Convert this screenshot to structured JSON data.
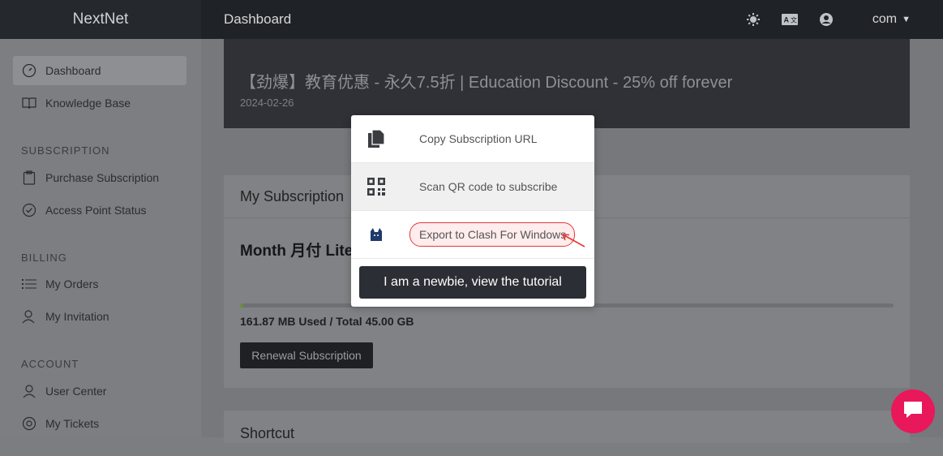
{
  "app": {
    "brand": "NextNet",
    "page_title": "Dashboard"
  },
  "topbar": {
    "theme_icon": "sun-icon",
    "language_icon": "translate-icon",
    "user_icon": "user-circle-icon",
    "user_name": "com"
  },
  "sidebar": {
    "items": [
      {
        "label": "Dashboard",
        "icon": "speedometer-icon",
        "active": true
      },
      {
        "label": "Knowledge Base",
        "icon": "book-icon"
      }
    ],
    "sections": [
      {
        "title": "SUBSCRIPTION",
        "items": [
          {
            "label": "Purchase Subscription",
            "icon": "clipboard-icon"
          },
          {
            "label": "Access Point Status",
            "icon": "check-circle-icon"
          }
        ]
      },
      {
        "title": "BILLING",
        "items": [
          {
            "label": "My Orders",
            "icon": "list-icon"
          },
          {
            "label": "My Invitation",
            "icon": "users-icon"
          }
        ]
      },
      {
        "title": "ACCOUNT",
        "items": [
          {
            "label": "User Center",
            "icon": "user-icon"
          },
          {
            "label": "My Tickets",
            "icon": "lifebuoy-icon"
          }
        ]
      }
    ]
  },
  "notice": {
    "title": "【劲爆】教育优惠 - 永久7.5折 | Education Discount - 25% off forever",
    "date": "2024-02-26"
  },
  "subscription_card": {
    "header": "My Subscription",
    "plan_name": "Month 月付 Lite",
    "usage_text": "161.87 MB Used / Total 45.00 GB",
    "usage_fraction": 0.0035,
    "renew_label": "Renewal Subscription"
  },
  "shortcut_card": {
    "header": "Shortcut"
  },
  "popup": {
    "items": [
      {
        "label": "Copy Subscription URL",
        "icon": "copy-icon"
      },
      {
        "label": "Scan QR code to subscribe",
        "icon": "qr-code-icon"
      },
      {
        "label": "Export to Clash For Windows",
        "icon": "clash-cat-icon"
      }
    ],
    "tutorial_label": "I am a newbie, view the tutorial"
  },
  "colors": {
    "accent": "#1f2227",
    "highlight": "#e23b3b",
    "chat": "#e8185a"
  }
}
